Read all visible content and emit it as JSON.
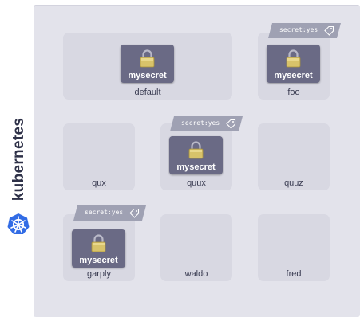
{
  "brand": {
    "name": "kubernetes",
    "logo_icon": "kubernetes-helm-icon",
    "logo_color": "#326ce5"
  },
  "colors": {
    "board": "#e3e3eb",
    "namespace": "#d8d8e2",
    "secret": "#6a6a85",
    "tag": "#9fa1b3",
    "lock_gold": "#d8c36a"
  },
  "namespaces": [
    {
      "name": "default",
      "secrets": [
        "mysecret"
      ],
      "label": ""
    },
    {
      "name": "foo",
      "secrets": [
        "mysecret"
      ],
      "label": "secret:yes"
    },
    {
      "name": "qux",
      "secrets": [],
      "label": ""
    },
    {
      "name": "quux",
      "secrets": [
        "mysecret"
      ],
      "label": "secret:yes"
    },
    {
      "name": "quuz",
      "secrets": [],
      "label": ""
    },
    {
      "name": "garply",
      "secrets": [
        "mysecret"
      ],
      "label": "secret:yes"
    },
    {
      "name": "waldo",
      "secrets": [],
      "label": ""
    },
    {
      "name": "fred",
      "secrets": [],
      "label": ""
    }
  ]
}
